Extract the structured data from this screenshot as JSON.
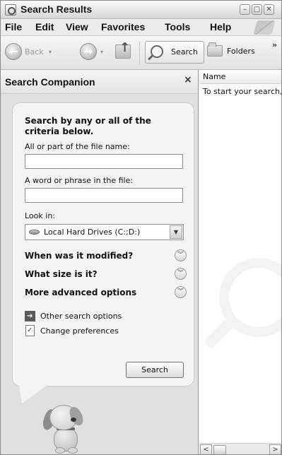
{
  "window": {
    "title": "Search Results",
    "controls": {
      "minimize": "–",
      "maximize": "□",
      "close": "✕"
    }
  },
  "menu": {
    "items": [
      "File",
      "Edit",
      "View",
      "Favorites",
      "Tools",
      "Help"
    ]
  },
  "toolbar": {
    "back_label": "Back",
    "back_glyph": "←",
    "forward_glyph": "→",
    "dropdown_glyph": "▾",
    "search_label": "Search",
    "folders_label": "Folders",
    "more_glyph": "»",
    "icons": [
      "back-arrow-icon",
      "forward-arrow-icon",
      "up-folder-icon",
      "search-icon",
      "folders-icon",
      "windows-logo-icon"
    ]
  },
  "search_pane": {
    "title": "Search Companion",
    "close_glyph": "×",
    "heading": "Search by any or all of the criteria below.",
    "filename_label": "All or part of the file name:",
    "filename_value": "",
    "phrase_label": "A word or phrase in the file:",
    "phrase_value": "",
    "look_in_label": "Look in:",
    "look_in_value": "Local Hard Drives (C:;D:)",
    "look_in_arrow": "▼",
    "advanced": [
      {
        "label": "When was it modified?",
        "glyph": "︾"
      },
      {
        "label": "What size is it?",
        "glyph": "︾"
      },
      {
        "label": "More advanced options",
        "glyph": "︾"
      }
    ],
    "links": [
      {
        "label": "Other search options",
        "icon": "arrow-right-icon",
        "glyph": "➔"
      },
      {
        "label": "Change preferences",
        "icon": "document-icon"
      }
    ],
    "search_button": "Search"
  },
  "results": {
    "column_name": "Name",
    "message": "To start your search, follow the instructions in the left pane."
  },
  "scrollbar": {
    "left_glyph": "<",
    "right_glyph": ">"
  }
}
